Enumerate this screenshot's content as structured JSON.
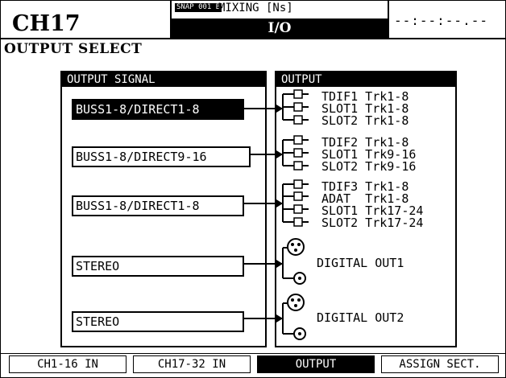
{
  "header": {
    "channel": "CH17",
    "snap_badge": "SNAP 001 B",
    "scene_title": "MIXING [Ns]",
    "page_name": "I/O",
    "timecode": "--:--:--.--"
  },
  "section_title": "OUTPUT SELECT",
  "signal_panel": {
    "heading": "OUTPUT SIGNAL",
    "rows": [
      {
        "label": "BUSS1-8/DIRECT1-8",
        "selected": true
      },
      {
        "label": "BUSS1-8/DIRECT9-16",
        "selected": false
      },
      {
        "label": "BUSS1-8/DIRECT1-8",
        "selected": false
      },
      {
        "label": "STEREO",
        "selected": false
      },
      {
        "label": "STEREO",
        "selected": false
      }
    ]
  },
  "output_panel": {
    "heading": "OUTPUT",
    "groups": [
      [
        "TDIF1 Trk1-8",
        "SLOT1 Trk1-8",
        "SLOT2 Trk1-8"
      ],
      [
        "TDIF2 Trk1-8",
        "SLOT1 Trk9-16",
        "SLOT2 Trk9-16"
      ],
      [
        "TDIF3 Trk1-8",
        "ADAT  Trk1-8",
        "SLOT1 Trk17-24",
        "SLOT2 Trk17-24"
      ]
    ],
    "digital": [
      "DIGITAL OUT1",
      "DIGITAL OUT2"
    ]
  },
  "tabs": [
    {
      "label": "CH1-16 IN",
      "active": false
    },
    {
      "label": "CH17-32 IN",
      "active": false
    },
    {
      "label": "OUTPUT",
      "active": true
    },
    {
      "label": "ASSIGN SECT.",
      "active": false
    }
  ],
  "icons": {
    "jack": "line-out-jack-icon",
    "xlr": "xlr-connector-icon",
    "coax": "coaxial-connector-icon"
  }
}
